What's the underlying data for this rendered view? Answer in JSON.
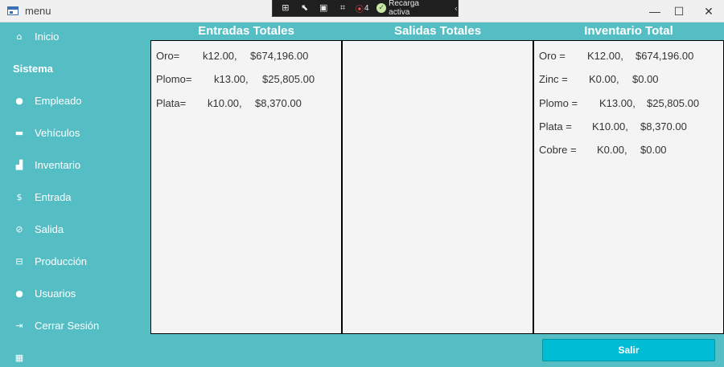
{
  "window": {
    "title": "menu",
    "minimize_glyph": "—",
    "maximize_glyph": "☐",
    "close_glyph": "✕"
  },
  "debug_toolbar": {
    "icons": [
      "live-visual-tree-icon",
      "select-element-icon",
      "display-layout-adorners-icon",
      "track-focus-icon"
    ],
    "binding_failures_count": "4",
    "hot_reload_label": "Recarga activa"
  },
  "sidebar": {
    "section_title": "Sistema",
    "items": [
      {
        "label": "Inicio",
        "icon": "home-icon"
      },
      {
        "label": "Empleado",
        "icon": "person-icon"
      },
      {
        "label": "Vehículos",
        "icon": "truck-icon"
      },
      {
        "label": "Inventario",
        "icon": "inventory-icon"
      },
      {
        "label": "Entrada",
        "icon": "dollar-icon"
      },
      {
        "label": "Salida",
        "icon": "money-off-icon"
      },
      {
        "label": "Producción",
        "icon": "factory-icon"
      },
      {
        "label": "Usuarios",
        "icon": "person-icon"
      },
      {
        "label": "Cerrar Sesión",
        "icon": "logout-icon"
      },
      {
        "label": "",
        "icon": "calendar-icon"
      }
    ]
  },
  "columns": {
    "entradas": {
      "title": "Entradas Totales",
      "rows": [
        {
          "name": "Oro=",
          "qty": "k12.00,",
          "value": "$674,196.00"
        },
        {
          "name": "Plomo=",
          "qty": "k13.00,",
          "value": "$25,805.00"
        },
        {
          "name": "Plata=",
          "qty": "k10.00,",
          "value": "$8,370.00"
        }
      ]
    },
    "salidas": {
      "title": "Salidas Totales",
      "rows": []
    },
    "inventario": {
      "title": "Inventario Total",
      "rows": [
        {
          "name": "Oro =",
          "qty": "K12.00,",
          "value": "$674,196.00"
        },
        {
          "name": "Zinc =",
          "qty": "K0.00,",
          "value": "$0.00"
        },
        {
          "name": "Plomo =",
          "qty": "K13.00,",
          "value": "$25,805.00"
        },
        {
          "name": "Plata =",
          "qty": "K10.00,",
          "value": "$8,370.00"
        },
        {
          "name": "Cobre =",
          "qty": "K0.00,",
          "value": "$0.00"
        }
      ]
    }
  },
  "exit_button": {
    "label": "Salir"
  }
}
